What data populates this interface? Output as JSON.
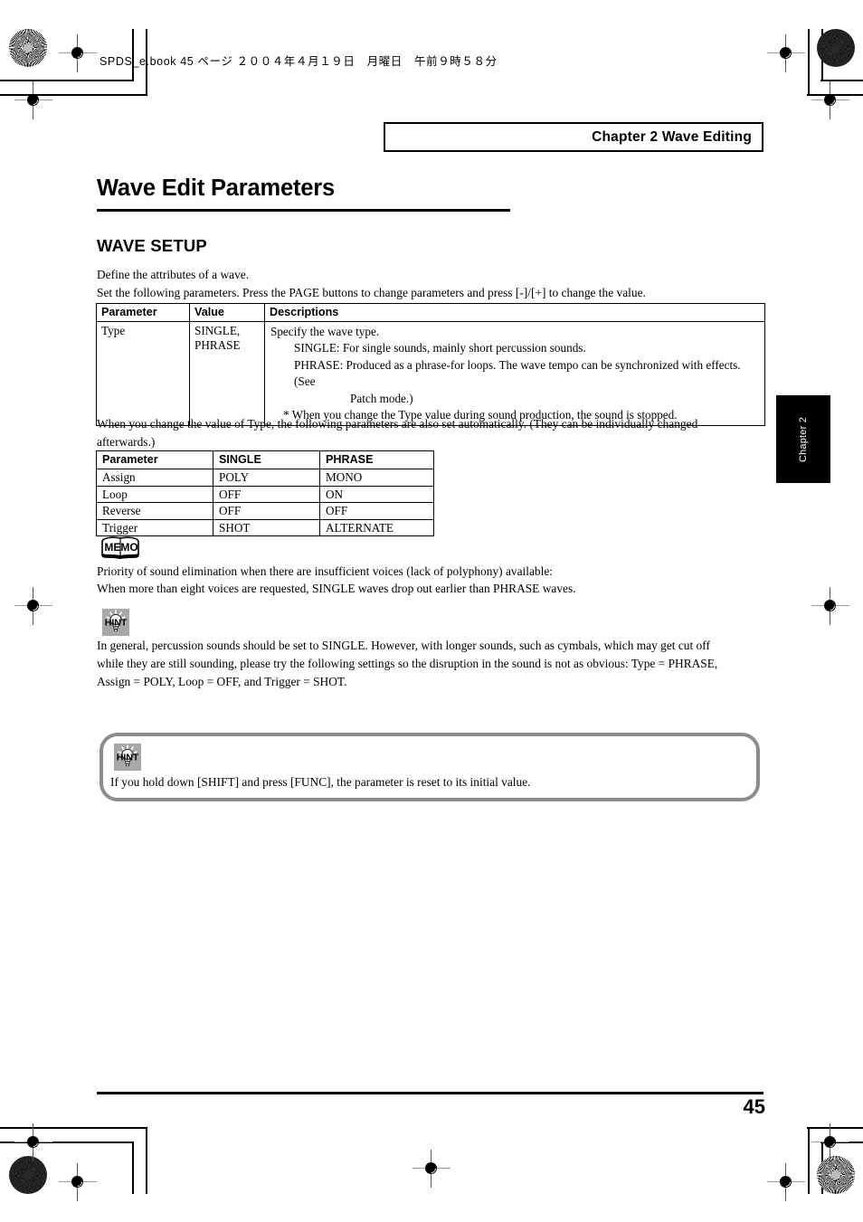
{
  "print_marks": {
    "filename_line": "SPDS_e.book  45 ページ  ２００４年４月１９日　月曜日　午前９時５８分"
  },
  "header": {
    "chapter_banner": "Chapter 2 Wave Editing"
  },
  "headings": {
    "title": "Wave Edit Parameters",
    "section": "WAVE SETUP"
  },
  "intro": {
    "line1": "Define the attributes of a wave.",
    "line2": "Set the following parameters. Press the PAGE buttons to change parameters and press [-]/[+] to change the value."
  },
  "table_type": {
    "headers": [
      "Parameter",
      "Value",
      "Descriptions"
    ],
    "row": {
      "parameter": "Type",
      "value_line1": "SINGLE,",
      "value_line2": "PHRASE",
      "desc_intro": "Specify the wave type.",
      "desc_single": "SINGLE: For single sounds, mainly short percussion sounds.",
      "desc_phrase": "PHRASE: Produced as a phrase-for loops. The wave tempo  can be synchronized with effects. (See",
      "desc_phrase_cont": "Patch mode.)",
      "desc_note": "* When you change the Type value during sound production, the sound is stopped."
    }
  },
  "auto_set_note": {
    "line1": "When you change the value of Type, the following parameters are also set automatically. (They can be individually changed",
    "line2": "afterwards.)"
  },
  "table_defaults": {
    "headers": [
      "Parameter",
      "SINGLE",
      "PHRASE"
    ],
    "rows": [
      {
        "parameter": "Assign",
        "single": "POLY",
        "phrase": "MONO"
      },
      {
        "parameter": "Loop",
        "single": "OFF",
        "phrase": "ON"
      },
      {
        "parameter": "Reverse",
        "single": "OFF",
        "phrase": "OFF"
      },
      {
        "parameter": "Trigger",
        "single": "SHOT",
        "phrase": "ALTERNATE"
      }
    ]
  },
  "memo": {
    "icon_label": "MEMO",
    "line1": "Priority of sound elimination when there are insufficient voices (lack of polyphony) available:",
    "line2": "When more than eight voices are requested, SINGLE waves drop out earlier than PHRASE waves."
  },
  "hint_inline": {
    "icon_label": "HINT",
    "line1": "In general, percussion sounds should be set to SINGLE. However, with longer sounds, such as cymbals, which may get cut off",
    "line2": "while they are still sounding, please try the following settings so the disruption in the sound is not as obvious: Type = PHRASE,",
    "line3": "Assign = POLY, Loop = OFF, and Trigger = SHOT."
  },
  "hint_box": {
    "icon_label": "HINT",
    "text": "If you hold down [SHIFT] and press [FUNC], the parameter is reset to its initial value."
  },
  "side_tab": {
    "label": "Chapter 2"
  },
  "footer": {
    "page_number": "45"
  },
  "colors": {
    "ink": "#000000",
    "hint_icon_bg": "#a8a8a8",
    "hint_box_border": "#8c8c8c"
  }
}
